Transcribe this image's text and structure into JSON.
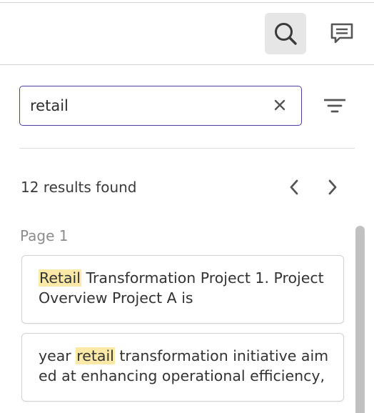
{
  "header": {
    "search_button_icon": "search-icon",
    "comments_button_icon": "comment-icon"
  },
  "search": {
    "value": "retail",
    "placeholder": "",
    "clear_icon": "close-icon",
    "filter_icon": "filter-icon"
  },
  "results": {
    "count_label": "12 results found",
    "prev_icon": "chevron-left-icon",
    "next_icon": "chevron-right-icon"
  },
  "page": {
    "label": "Page 1"
  },
  "cards": [
    {
      "before": "",
      "highlight": "Retail",
      "after": " Transformation Project 1. Project Overview Project A is"
    },
    {
      "before": "year ",
      "highlight": "retail",
      "after": " transformation initiative aimed at enhancing operational efficiency,"
    }
  ],
  "colors": {
    "accent_border": "#4b3fa6",
    "highlight": "#fce9a7",
    "toggle_bg": "#e6e6e6"
  }
}
